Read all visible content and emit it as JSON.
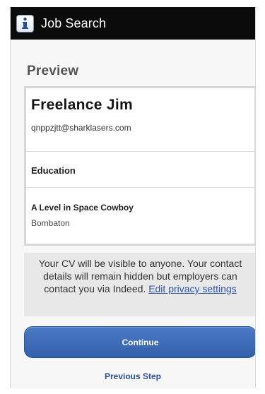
{
  "app_bar": {
    "title": "Job Search",
    "icon": "info-icon"
  },
  "preview": {
    "section_title": "Preview",
    "name": "Freelance Jim",
    "email": "qnppzjtt@sharklasers.com",
    "education_heading": "Education",
    "qualification": {
      "title": "A Level in Space Cowboy",
      "place": "Bombaton"
    }
  },
  "notice": {
    "text": "Your CV will be visible to anyone. Your contact details will remain hidden but employers can contact you via Indeed.",
    "link_text": "Edit privacy settings"
  },
  "actions": {
    "continue_label": "Continue",
    "previous_label": "Previous Step"
  },
  "colors": {
    "app_bar": "#0b0b0b",
    "accent": "#3d69b5",
    "link": "#2e55a5"
  }
}
